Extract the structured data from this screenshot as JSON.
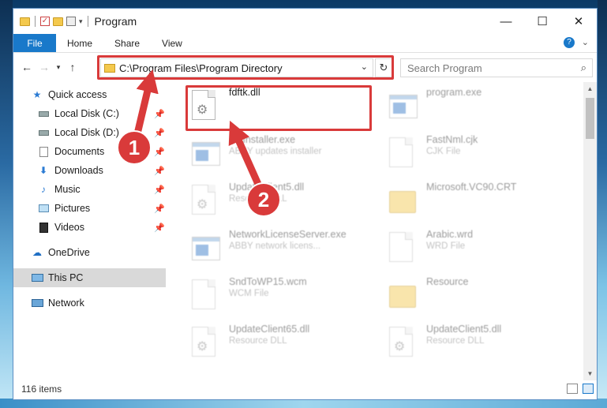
{
  "window": {
    "title": "Program",
    "controls": {
      "minimize": "—",
      "maximize": "☐",
      "close": "✕"
    }
  },
  "ribbon": {
    "tabs": [
      {
        "label": "File",
        "active": true
      },
      {
        "label": "Home"
      },
      {
        "label": "Share"
      },
      {
        "label": "View"
      }
    ]
  },
  "address_bar": {
    "path": "C:\\Program Files\\Program Directory",
    "dropdown_icon": "chevron-down-icon",
    "refresh_icon": "refresh-icon"
  },
  "search": {
    "placeholder": "Search Program"
  },
  "sidebar": {
    "items": [
      {
        "label": "Quick access",
        "icon": "star-icon",
        "pinned": false
      },
      {
        "label": "Local Disk (C:)",
        "icon": "drive-icon",
        "pinned": true
      },
      {
        "label": "Local Disk (D:)",
        "icon": "drive-icon",
        "pinned": true
      },
      {
        "label": "Documents",
        "icon": "documents-icon",
        "pinned": true
      },
      {
        "label": "Downloads",
        "icon": "download-icon",
        "pinned": true
      },
      {
        "label": "Music",
        "icon": "music-icon",
        "pinned": true
      },
      {
        "label": "Pictures",
        "icon": "pictures-icon",
        "pinned": true
      },
      {
        "label": "Videos",
        "icon": "videos-icon",
        "pinned": true
      },
      {
        "label": "OneDrive",
        "icon": "cloud-icon",
        "pinned": false
      },
      {
        "label": "This PC",
        "icon": "computer-icon",
        "pinned": false,
        "selected": true
      },
      {
        "label": "Network",
        "icon": "network-icon",
        "pinned": false
      }
    ]
  },
  "files": [
    {
      "name": "fdftk.dll",
      "desc": "",
      "type": "dll",
      "highlighted": true
    },
    {
      "name": "program.exe",
      "desc": "",
      "type": "exe-app"
    },
    {
      "name": "ateInstaller.exe",
      "desc": "ABBY updates installer",
      "type": "exe"
    },
    {
      "name": "FastNml.cjk",
      "desc": "CJK File",
      "type": "doc"
    },
    {
      "name": "UpdateClient5.dll",
      "desc": "Resource DLL",
      "type": "dll"
    },
    {
      "name": "Microsoft.VC90.CRT",
      "desc": "",
      "type": "folder"
    },
    {
      "name": "NetworkLicenseServer.exe",
      "desc": "ABBY network licens...",
      "type": "exe"
    },
    {
      "name": "Arabic.wrd",
      "desc": "WRD File",
      "type": "doc"
    },
    {
      "name": "SndToWP15.wcm",
      "desc": "WCM File",
      "type": "doc"
    },
    {
      "name": "Resource",
      "desc": "",
      "type": "folder"
    },
    {
      "name": "UpdateClient65.dll",
      "desc": "Resource DLL",
      "type": "dll"
    },
    {
      "name": "UpdateClient5.dll",
      "desc": "Resource DLL",
      "type": "dll"
    }
  ],
  "status": {
    "item_count": "116 items"
  },
  "annotations": [
    {
      "number": "1",
      "color": "#d93a3a"
    },
    {
      "number": "2",
      "color": "#d93a3a"
    }
  ]
}
